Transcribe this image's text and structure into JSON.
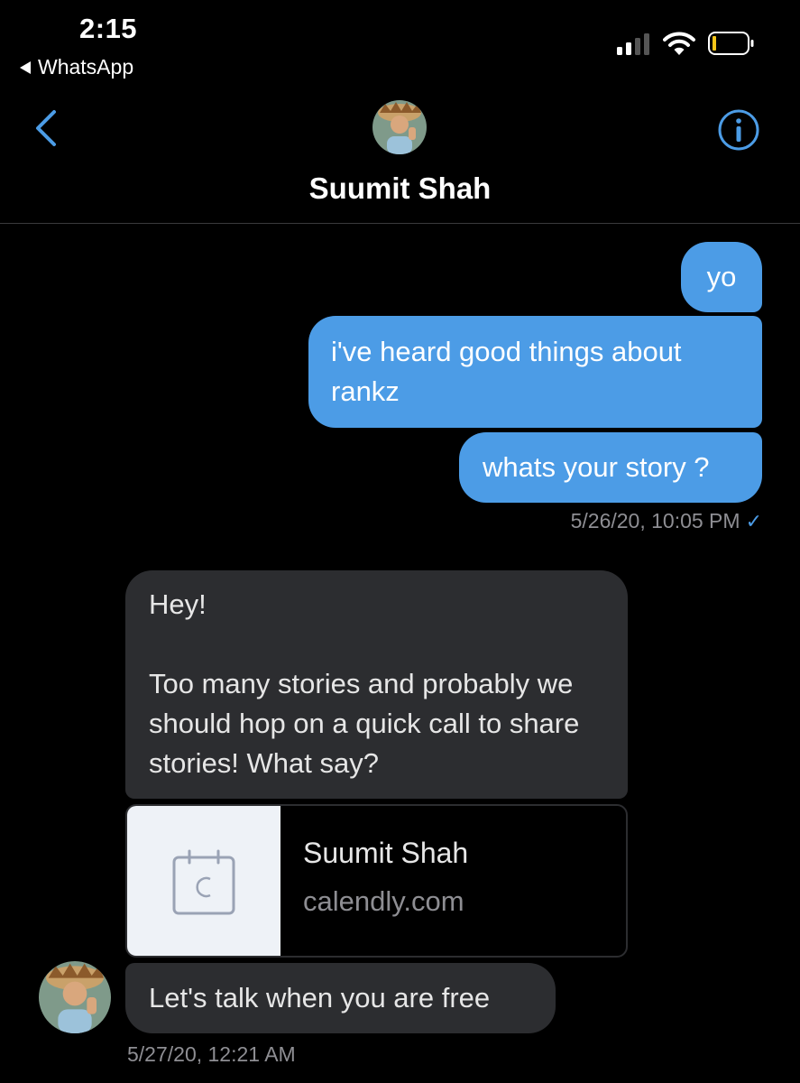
{
  "status_bar": {
    "time": "2:15",
    "back_app_label": "WhatsApp",
    "icons": [
      "cellular-signal-icon",
      "wifi-icon",
      "battery-icon"
    ]
  },
  "nav": {
    "back_icon": "chevron-left-icon",
    "info_icon": "info-icon",
    "contact_name": "Suumit Shah",
    "accent_color": "#4c9ce6"
  },
  "messages": {
    "outgoing": [
      {
        "text": "yo"
      },
      {
        "text": "i've heard good things about rankz"
      },
      {
        "text": "whats your story ?"
      }
    ],
    "outgoing_timestamp": "5/26/20, 10:05 PM",
    "outgoing_status_icon": "checkmark-icon",
    "incoming_block": {
      "line1": "Hey!",
      "line2": "Too many stories and probably we should hop on a quick call to share stories! What say?"
    },
    "link_preview": {
      "title": "Suumit Shah",
      "domain": "calendly.com",
      "thumb_icon": "calendar-icon"
    },
    "incoming_last": {
      "text": "Let's talk when you are free"
    },
    "incoming_timestamp": "5/27/20, 12:21 AM"
  },
  "colors": {
    "outgoing_bubble": "#4c9ce6",
    "incoming_bubble": "#2c2d30",
    "background": "#000000",
    "secondary_text": "#8e8e93"
  }
}
